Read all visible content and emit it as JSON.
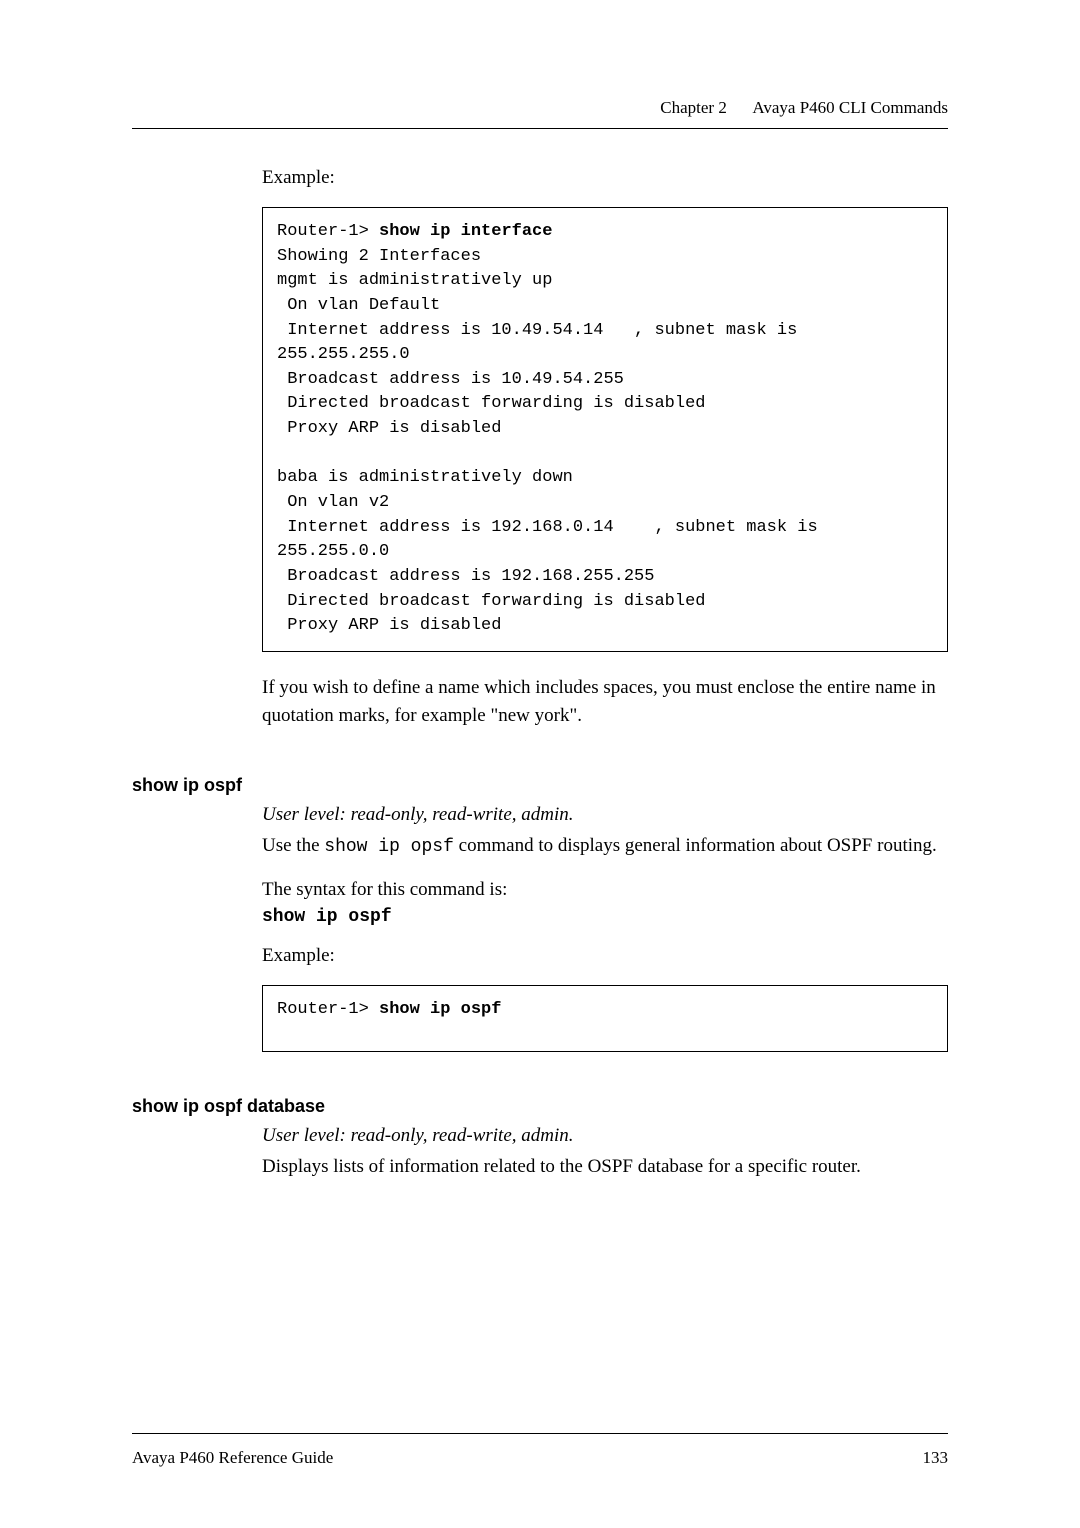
{
  "header": {
    "chapter": "Chapter 2",
    "title": "Avaya P460 CLI Commands"
  },
  "example_label": "Example:",
  "code1": {
    "prompt": "Router-1> ",
    "cmd": "show ip interface",
    "body": "Showing 2 Interfaces\nmgmt is administratively up\n On vlan Default\n Internet address is 10.49.54.14   , subnet mask is\n255.255.255.0\n Broadcast address is 10.49.54.255\n Directed broadcast forwarding is disabled\n Proxy ARP is disabled\n\nbaba is administratively down\n On vlan v2\n Internet address is 192.168.0.14    , subnet mask is\n255.255.0.0\n Broadcast address is 192.168.255.255\n Directed broadcast forwarding is disabled\n Proxy ARP is disabled"
  },
  "after_box": "If you wish to define a name which includes spaces, you must enclose the entire name in quotation marks, for example \"new york\".",
  "sec1": {
    "title": "show ip ospf",
    "userlevel": "User level: read-only, read-write, admin.",
    "desc_pre": "Use the ",
    "desc_mono": "show ip opsf",
    "desc_post": " command to displays general information about OSPF routing.",
    "syntax_label": "The syntax for this command is:",
    "syntax_cmd": "show ip ospf",
    "example_label": "Example:",
    "code_prompt": "Router-1> ",
    "code_cmd": "show ip ospf"
  },
  "sec2": {
    "title": "show ip ospf database",
    "userlevel": "User level: read-only, read-write, admin.",
    "desc": "Displays lists of information related to the OSPF database for a specific router."
  },
  "footer": {
    "left": "Avaya P460 Reference Guide",
    "right": "133"
  }
}
